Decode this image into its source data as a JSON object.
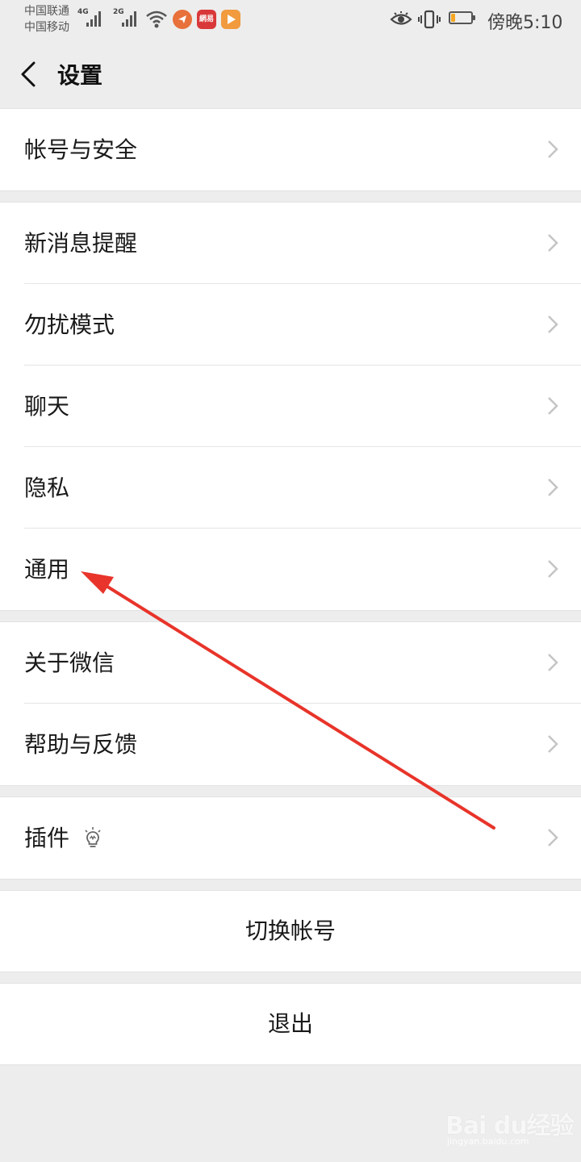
{
  "status_bar": {
    "carrier_1": "中国联通",
    "carrier_2": "中国移动",
    "network_1": "4G",
    "network_2": "2G",
    "app_icon_2_text": "網易",
    "time": "傍晚5:10",
    "battery_level": 0.22,
    "colors": {
      "battery": "#f5a623",
      "app_1": "#e8703a",
      "app_2": "#d9383a",
      "app_3": "#f19a3e"
    },
    "icons": [
      "signal-icon",
      "wifi-icon",
      "app-notification-icon",
      "eye-icon",
      "vibrate-icon",
      "battery-icon"
    ]
  },
  "nav": {
    "title": "设置",
    "back_icon": "chevron-left-icon"
  },
  "groups": [
    {
      "items": [
        {
          "label": "帐号与安全"
        }
      ]
    },
    {
      "items": [
        {
          "label": "新消息提醒"
        },
        {
          "label": "勿扰模式"
        },
        {
          "label": "聊天"
        },
        {
          "label": "隐私"
        },
        {
          "label": "通用"
        }
      ]
    },
    {
      "items": [
        {
          "label": "关于微信"
        },
        {
          "label": "帮助与反馈"
        }
      ]
    },
    {
      "items": [
        {
          "label": "插件",
          "icon": "lightbulb-icon"
        }
      ]
    }
  ],
  "actions": {
    "switch_account": "切换帐号",
    "logout": "退出"
  },
  "annotation": {
    "color": "#e8342a",
    "points_to": "通用"
  },
  "watermark": {
    "brand": "Bai du经验",
    "url": "jingyan.baidu.com"
  }
}
